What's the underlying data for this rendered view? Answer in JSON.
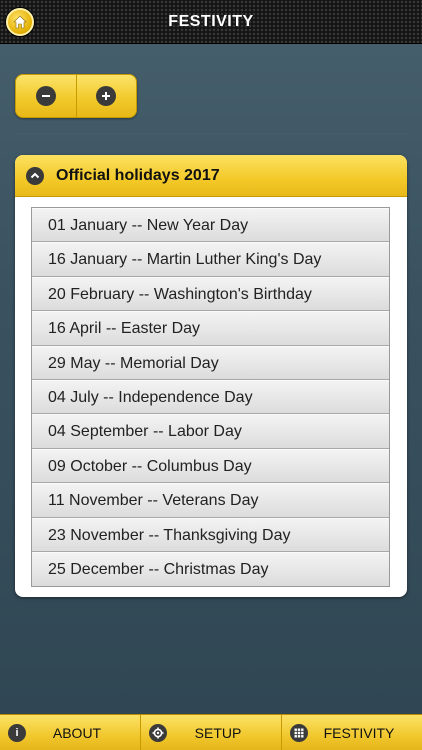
{
  "header": {
    "title": "FESTIVITY",
    "home_icon": "home-icon"
  },
  "zoom": {
    "minus_icon": "minus-circle-icon",
    "plus_icon": "plus-circle-icon"
  },
  "panel": {
    "title": "Official holidays 2017",
    "collapse_icon": "chevron-up-circle-icon",
    "items": [
      {
        "label": "01 January -- New Year Day"
      },
      {
        "label": "16 January -- Martin Luther King's Day"
      },
      {
        "label": "20 February -- Washington's Birthday"
      },
      {
        "label": "16 April -- Easter Day"
      },
      {
        "label": "29 May -- Memorial Day"
      },
      {
        "label": "04 July -- Independence Day"
      },
      {
        "label": "04 September -- Labor Day"
      },
      {
        "label": "09 October -- Columbus Day"
      },
      {
        "label": "11 November -- Veterans Day"
      },
      {
        "label": "23 November -- Thanksgiving Day"
      },
      {
        "label": "25 December -- Christmas Day"
      }
    ]
  },
  "navbar": {
    "items": [
      {
        "label": "ABOUT",
        "icon": "info-icon"
      },
      {
        "label": "SETUP",
        "icon": "gear-icon"
      },
      {
        "label": "FESTIVITY",
        "icon": "grid-icon"
      }
    ]
  },
  "colors": {
    "accent": "#f3c928",
    "header_bg": "#151515",
    "background": "#3a5260"
  }
}
